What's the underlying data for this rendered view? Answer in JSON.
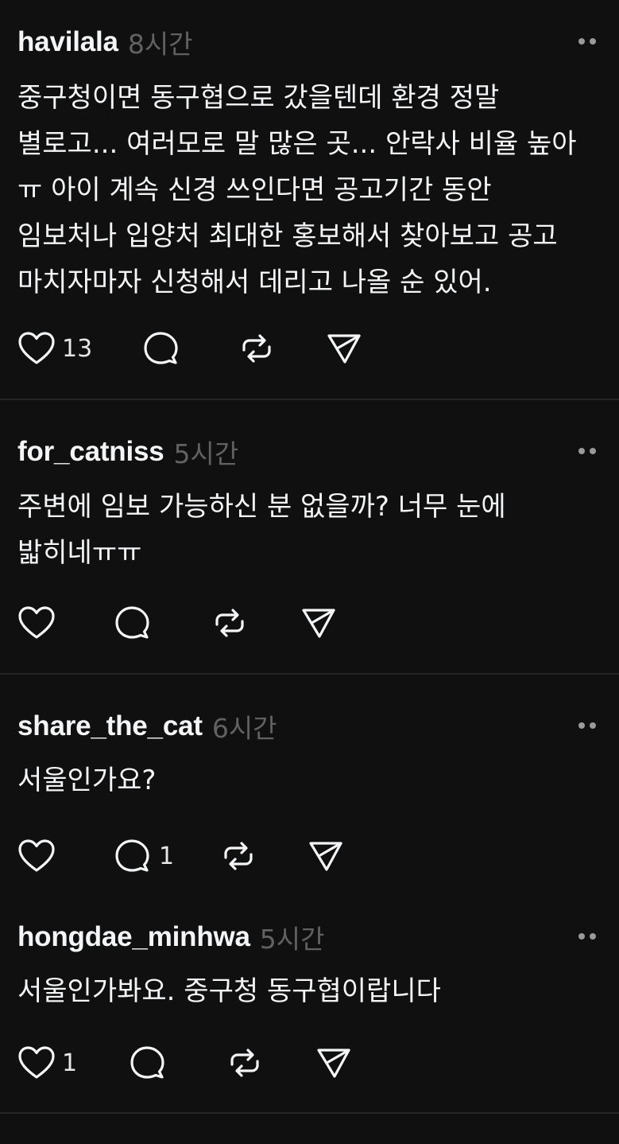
{
  "posts": [
    {
      "username": "havilala",
      "time": "8시간",
      "lines": [
        "중구청이면 동구협으로 갔을텐데 환경 정말",
        "별로고... 여러모로 말 많은 곳... 안락사 비율 높아",
        "ㅠ 아이 계속 신경 쓰인다면 공고기간 동안",
        "임보처나 입양처 최대한 홍보해서 찾아보고 공고",
        "마치자마자 신청해서 데리고 나올 순 있어."
      ],
      "like_count": "13",
      "reply_count": ""
    },
    {
      "username": "for_catniss",
      "time": "5시간",
      "lines": [
        "주변에 임보 가능하신 분 없을까? 너무 눈에",
        "밟히네ㅠㅠ"
      ],
      "like_count": "",
      "reply_count": ""
    },
    {
      "username": "share_the_cat",
      "time": "6시간",
      "lines": [
        "서울인가요?"
      ],
      "like_count": "",
      "reply_count": "1"
    },
    {
      "username": "hongdae_minhwa",
      "time": "5시간",
      "lines": [
        "서울인가봐요. 중구청 동구협이랍니다"
      ],
      "like_count": "1",
      "reply_count": ""
    }
  ],
  "icons": {
    "like": "heart-icon",
    "reply": "comment-bubble-icon",
    "repost": "repost-icon",
    "share": "send-icon",
    "more": "more-dots-icon"
  },
  "colors": {
    "background": "#101010",
    "text": "#f3f5f7",
    "muted": "#616161",
    "divider": "#262626"
  }
}
